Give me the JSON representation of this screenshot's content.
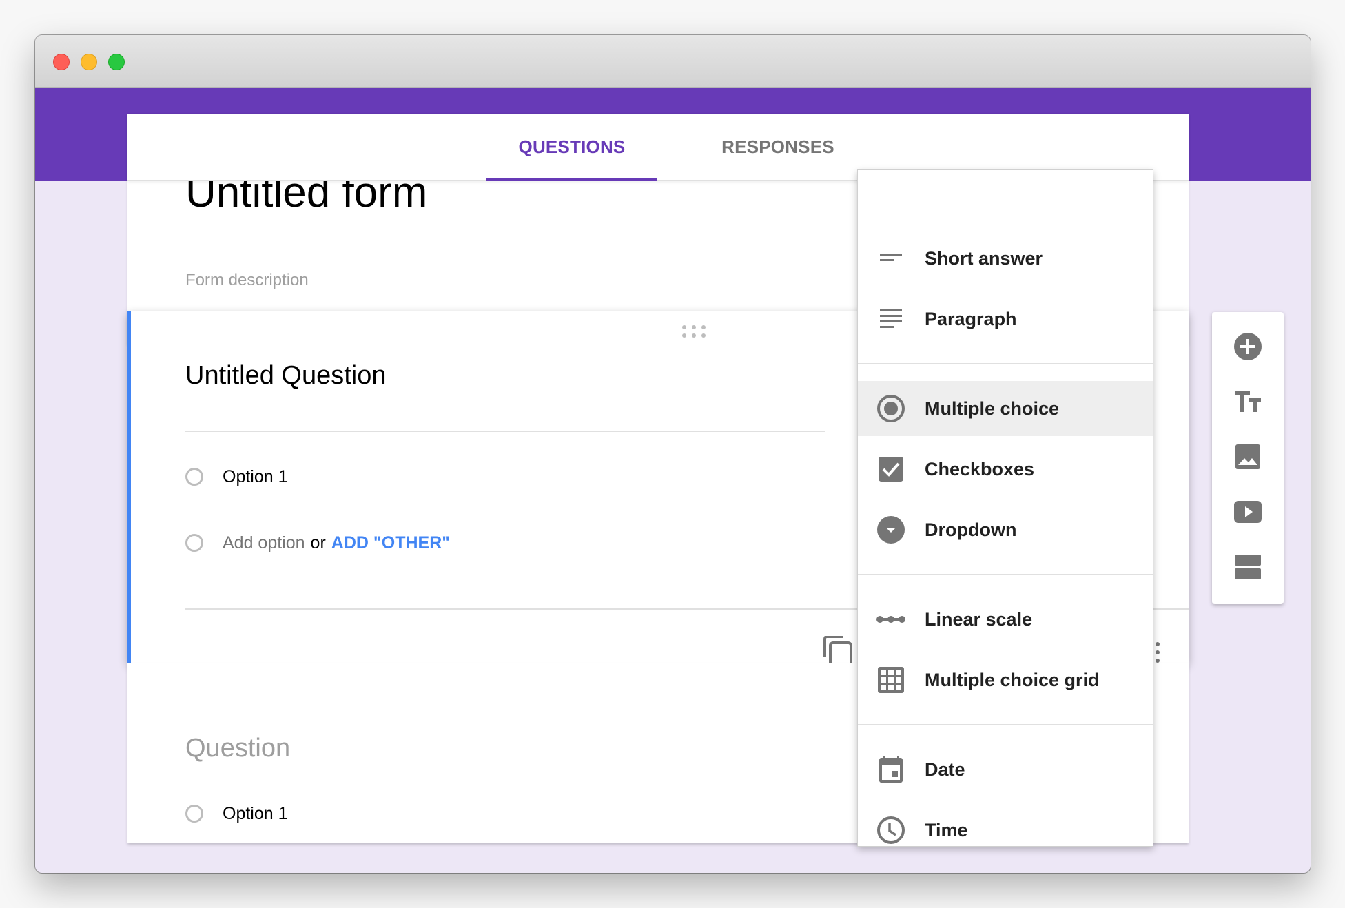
{
  "window": {
    "controls": [
      "close",
      "minimize",
      "maximize"
    ]
  },
  "colors": {
    "brand": "#673ab7",
    "accent_blue": "#4285f4",
    "background": "#ede7f6",
    "icon_grey": "#757575"
  },
  "tabs": [
    {
      "label": "QUESTIONS",
      "active": true
    },
    {
      "label": "RESPONSES",
      "active": false
    }
  ],
  "form": {
    "title": "Untitled form",
    "description_placeholder": "Form description"
  },
  "active_question": {
    "title": "Untitled Question",
    "options": [
      {
        "label": "Option 1"
      }
    ],
    "add_option": {
      "placeholder": "Add option",
      "or": "or",
      "add_other": "ADD \"OTHER\""
    },
    "footer_icons": [
      "copy-icon",
      "more-vert-icon"
    ]
  },
  "second_question": {
    "title_placeholder": "Question",
    "options": [
      {
        "label": "Option 1"
      }
    ]
  },
  "question_type_menu": {
    "groups": [
      [
        {
          "label": "Short answer",
          "icon": "short-text-icon"
        },
        {
          "label": "Paragraph",
          "icon": "paragraph-icon"
        }
      ],
      [
        {
          "label": "Multiple choice",
          "icon": "radio-button-icon",
          "selected": true
        },
        {
          "label": "Checkboxes",
          "icon": "checkbox-icon"
        },
        {
          "label": "Dropdown",
          "icon": "dropdown-icon"
        }
      ],
      [
        {
          "label": "Linear scale",
          "icon": "linear-scale-icon"
        },
        {
          "label": "Multiple choice grid",
          "icon": "grid-icon"
        }
      ],
      [
        {
          "label": "Date",
          "icon": "calendar-icon"
        },
        {
          "label": "Time",
          "icon": "clock-icon"
        }
      ]
    ]
  },
  "side_toolbar": {
    "buttons": [
      {
        "name": "add-question",
        "icon": "add-circle-icon"
      },
      {
        "name": "add-title",
        "icon": "title-text-icon"
      },
      {
        "name": "add-image",
        "icon": "image-icon"
      },
      {
        "name": "add-video",
        "icon": "video-icon"
      },
      {
        "name": "add-section",
        "icon": "section-icon"
      }
    ]
  }
}
